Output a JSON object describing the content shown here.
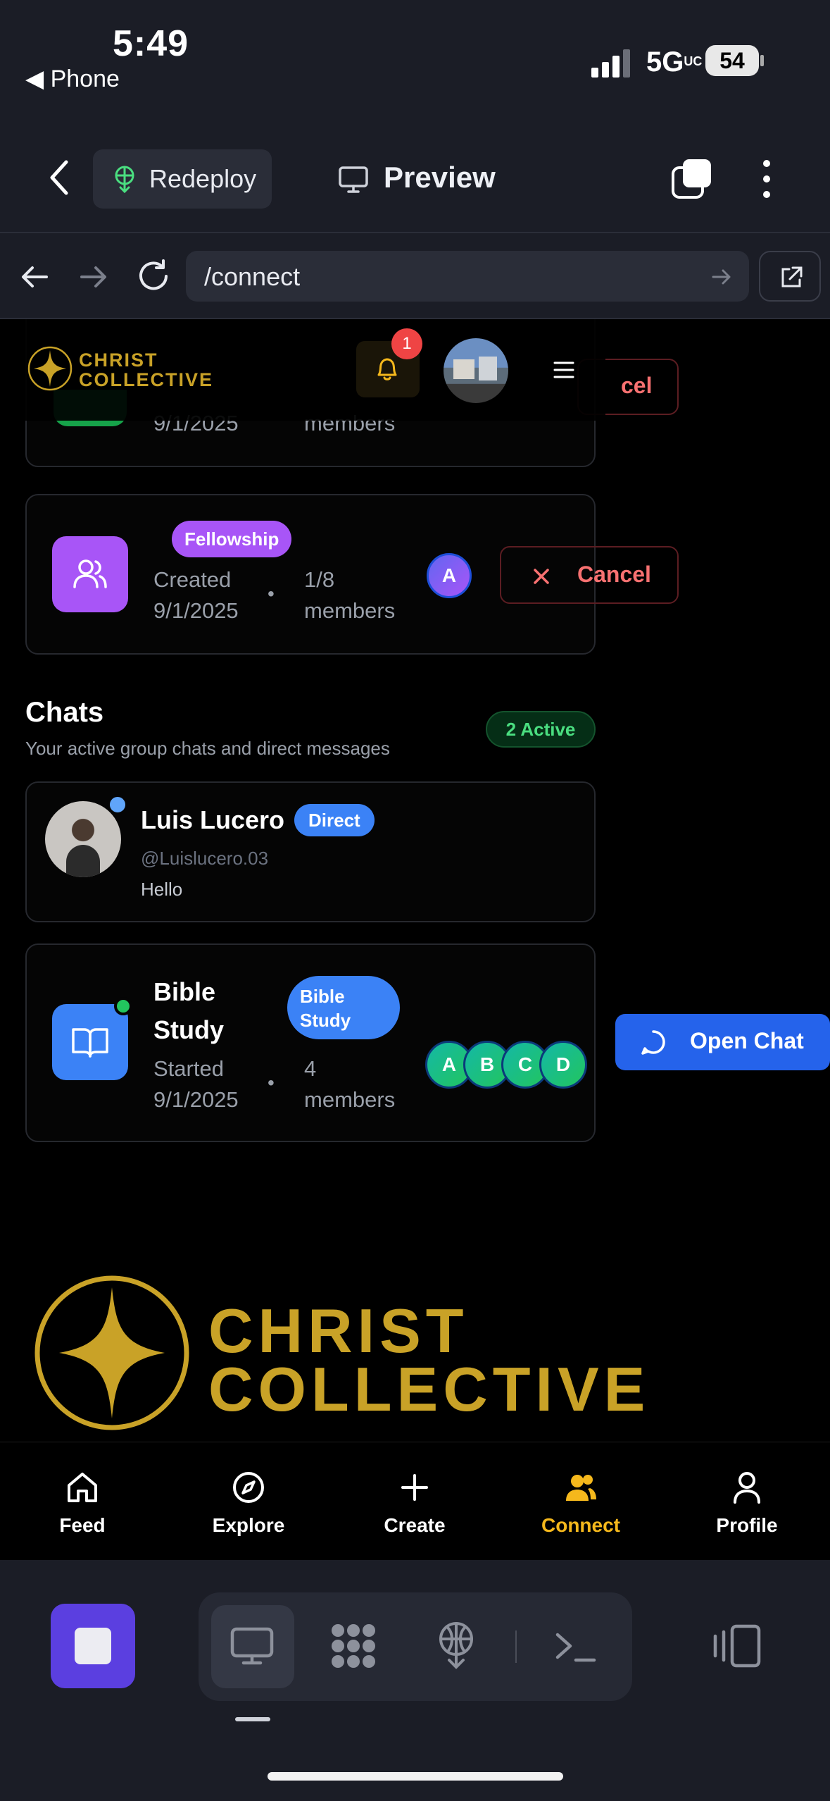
{
  "status_bar": {
    "time": "5:49",
    "back_app": "◀ Phone",
    "network": "5G",
    "network_sup": "UC",
    "battery": "54"
  },
  "toolbar": {
    "redeploy_label": "Redeploy",
    "preview_label": "Preview"
  },
  "url_bar": {
    "url": "/connect"
  },
  "app": {
    "logo_line1": "CHRIST",
    "logo_line2": "COLLECTIVE",
    "notification_count": "1"
  },
  "partial_group": {
    "created_date": "9/1/2025",
    "members": "members",
    "cancel_label": "cel"
  },
  "group_card": {
    "badge": "Fellowship",
    "created_label": "Created",
    "created_date": "9/1/2025",
    "dot": "•",
    "member_count": "1/8",
    "members_label": "members",
    "member_avatar": "A",
    "cancel_label": "Cancel"
  },
  "chats": {
    "title": "Chats",
    "subtitle": "Your active group chats and direct messages",
    "active_badge": "2 Active",
    "items": [
      {
        "name": "Luis Lucero",
        "type_badge": "Direct",
        "handle": "@Luislucero.03",
        "last_message": "Hello"
      },
      {
        "name_line1": "Bible",
        "name_line2": "Study",
        "type_badge_line1": "Bible",
        "type_badge_line2": "Study",
        "started_label": "Started",
        "started_date": "9/1/2025",
        "dot": "•",
        "member_count": "4",
        "members_label": "members",
        "member_avatars": [
          "A",
          "B",
          "C",
          "D"
        ],
        "open_label": "Open Chat"
      }
    ]
  },
  "footer_logo": {
    "line1": "CHRIST",
    "line2": "COLLECTIVE"
  },
  "bottom_nav": [
    {
      "label": "Feed",
      "icon": "home-icon",
      "active": false
    },
    {
      "label": "Explore",
      "icon": "compass-icon",
      "active": false
    },
    {
      "label": "Create",
      "icon": "plus-icon",
      "active": false
    },
    {
      "label": "Connect",
      "icon": "users-icon",
      "active": true
    },
    {
      "label": "Profile",
      "icon": "user-icon",
      "active": false
    }
  ],
  "colors": {
    "gold": "#c9a227",
    "accent_blue": "#2563eb",
    "badge_blue": "#3b82f6",
    "purple": "#a855f7",
    "green": "#22c55e",
    "danger": "#f87171",
    "connect_active": "#f5b81c"
  }
}
